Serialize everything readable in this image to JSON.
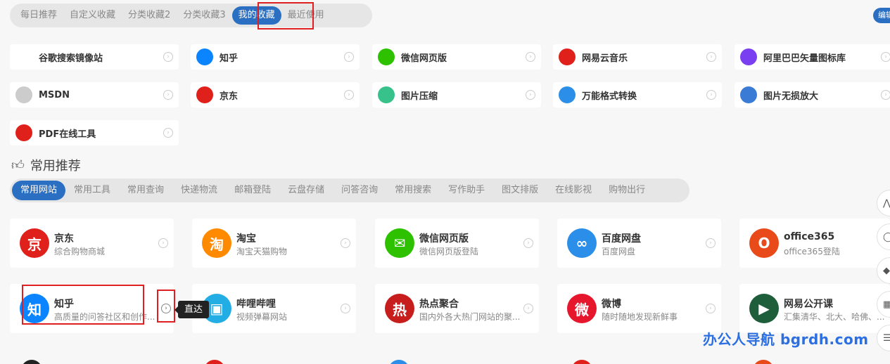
{
  "top_tabs": [
    "每日推荐",
    "自定义收藏",
    "分类收藏2",
    "分类收藏3",
    "我的收藏",
    "最近使用"
  ],
  "active_top_tab": "我的收藏",
  "edit_button": "编辑",
  "favorites": [
    {
      "name": "谷歌搜索镜像站",
      "icon": "google-icon",
      "color": "#ffffff"
    },
    {
      "name": "知乎",
      "icon": "zhihu-icon",
      "color": "#0a84ff"
    },
    {
      "name": "微信网页版",
      "icon": "wechat-icon",
      "color": "#2dc100"
    },
    {
      "name": "网易云音乐",
      "icon": "netease-music-icon",
      "color": "#e0201a"
    },
    {
      "name": "阿里巴巴矢量图标库",
      "icon": "iconfont-icon",
      "color": "#7b3ff2"
    },
    {
      "name": "MSDN",
      "icon": "msdn-icon",
      "color": "#cccccc"
    },
    {
      "name": "京东",
      "icon": "jd-icon",
      "color": "#e0201a"
    },
    {
      "name": "图片压缩",
      "icon": "image-compress-icon",
      "color": "#36c28a"
    },
    {
      "name": "万能格式转换",
      "icon": "format-convert-icon",
      "color": "#2b8ee8"
    },
    {
      "name": "图片无损放大",
      "icon": "image-upscale-icon",
      "color": "#3a7bd5"
    },
    {
      "name": "PDF在线工具",
      "icon": "pdf-icon",
      "color": "#e0201a"
    }
  ],
  "section_title": "常用推荐",
  "sub_tabs": [
    "常用网站",
    "常用工具",
    "常用查询",
    "快递物流",
    "邮箱登陆",
    "云盘存储",
    "问答咨询",
    "常用搜索",
    "写作助手",
    "图文排版",
    "在线影视",
    "购物出行"
  ],
  "active_sub_tab": "常用网站",
  "sites": [
    {
      "name": "京东",
      "desc": "综合购物商城",
      "icon": "jd-icon",
      "glyph": "京",
      "color": "#e0201a"
    },
    {
      "name": "淘宝",
      "desc": "淘宝天猫购物",
      "icon": "taobao-icon",
      "glyph": "淘",
      "color": "#ff8a00"
    },
    {
      "name": "微信网页版",
      "desc": "微信网页版登陆",
      "icon": "wechat-icon",
      "glyph": "✉",
      "color": "#2dc100"
    },
    {
      "name": "百度网盘",
      "desc": "百度网盘",
      "icon": "baidu-pan-icon",
      "glyph": "∞",
      "color": "#2b8ee8"
    },
    {
      "name": "office365",
      "desc": "office365登陆",
      "icon": "office-icon",
      "glyph": "O",
      "color": "#e84a1a"
    },
    {
      "name": "知乎",
      "desc": "高质量的问答社区和创作...",
      "icon": "zhihu-icon",
      "glyph": "知",
      "color": "#0a84ff"
    },
    {
      "name": "哔哩哔哩",
      "desc": "视频弹幕网站",
      "icon": "bilibili-icon",
      "glyph": "▣",
      "color": "#23ade5"
    },
    {
      "name": "热点聚合",
      "desc": "国内外各大热门网站的聚...",
      "icon": "hot-icon",
      "glyph": "热",
      "color": "#c81d1d"
    },
    {
      "name": "微博",
      "desc": "随时随地发现新鲜事",
      "icon": "weibo-icon",
      "glyph": "微",
      "color": "#e6162d"
    },
    {
      "name": "网易公开课",
      "desc": "汇集清华、北大、哈佛、...",
      "icon": "netease-open-icon",
      "glyph": "▶",
      "color": "#1f5e3a"
    }
  ],
  "tooltip": "直达",
  "watermark": "办公人导航 bgrdh.com"
}
